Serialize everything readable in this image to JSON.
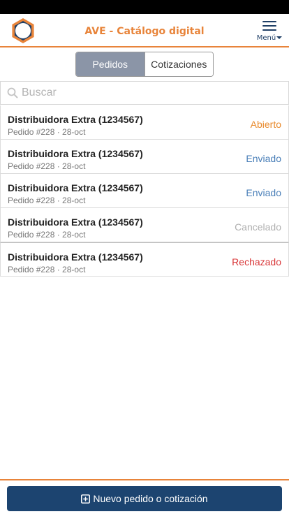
{
  "header": {
    "title": "AVE - Catálogo digital",
    "menu_label": "Menú",
    "logo_icon": "hexagon-ring-logo-icon",
    "menu_icon": "hamburger-icon",
    "accent_color": "#e8843a",
    "brand_navy": "#1c4470"
  },
  "tabs": [
    {
      "label": "Pedidos",
      "active": true
    },
    {
      "label": "Cotizaciones",
      "active": false
    }
  ],
  "search": {
    "placeholder": "Buscar",
    "value": "",
    "icon": "search-icon"
  },
  "orders": [
    {
      "name": "Distribuidora Extra (1234567)",
      "detail": "Pedido #228 · 28-oct",
      "status": "Abierto",
      "status_color": "#e8892b"
    },
    {
      "name": "Distribuidora Extra (1234567)",
      "detail": "Pedido #228 · 28-oct",
      "status": "Enviado",
      "status_color": "#4a7fb8"
    },
    {
      "name": "Distribuidora Extra (1234567)",
      "detail": "Pedido #228 · 28-oct",
      "status": "Enviado",
      "status_color": "#4a7fb8"
    },
    {
      "name": "Distribuidora Extra (1234567)",
      "detail": "Pedido #228 · 28-oct",
      "status": "Cancelado",
      "status_color": "#b0b0b0"
    },
    {
      "name": "Distribuidora Extra (1234567)",
      "detail": "Pedido #228 · 28-oct",
      "status": "Rechazado",
      "status_color": "#d9383a"
    }
  ],
  "footer": {
    "new_button_label": "Nuevo pedido o cotización",
    "new_button_icon": "plus-square-icon"
  }
}
